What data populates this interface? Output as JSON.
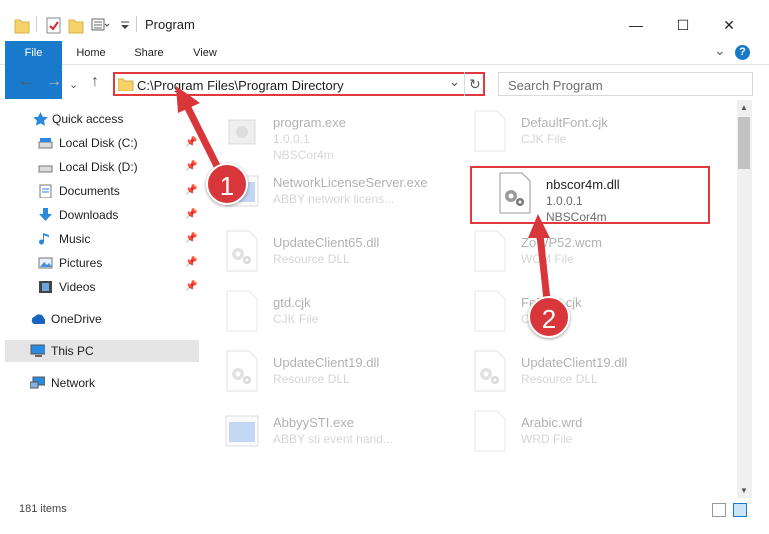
{
  "window": {
    "title": "Program",
    "minimize_glyph": "—",
    "maximize_glyph": "☐",
    "close_glyph": "✕"
  },
  "ribbon": {
    "tabs": [
      "File",
      "Home",
      "Share",
      "View"
    ],
    "collapse_glyph": "⌄",
    "help_glyph": "?"
  },
  "address": {
    "path": "C:\\Program Files\\Program Directory",
    "dropdown_glyph": "⌄",
    "refresh_glyph": "↻"
  },
  "search": {
    "placeholder": "Search Program"
  },
  "sidebar": {
    "items": [
      {
        "label": "Quick access",
        "icon": "star-icon",
        "pinned": false
      },
      {
        "label": "Local Disk (C:)",
        "icon": "drive-icon",
        "pinned": true
      },
      {
        "label": "Local Disk (D:)",
        "icon": "drive-icon",
        "pinned": true
      },
      {
        "label": "Documents",
        "icon": "documents-icon",
        "pinned": true
      },
      {
        "label": "Downloads",
        "icon": "download-icon",
        "pinned": true
      },
      {
        "label": "Music",
        "icon": "music-icon",
        "pinned": true
      },
      {
        "label": "Pictures",
        "icon": "pictures-icon",
        "pinned": true
      },
      {
        "label": "Videos",
        "icon": "videos-icon",
        "pinned": true
      },
      {
        "label": "OneDrive",
        "icon": "cloud-icon",
        "pinned": false
      },
      {
        "label": "This PC",
        "icon": "computer-icon",
        "pinned": false,
        "selected": true
      },
      {
        "label": "Network",
        "icon": "network-icon",
        "pinned": false
      }
    ]
  },
  "files": [
    {
      "name": "program.exe",
      "line2": "1.0.0.1",
      "line3": "NBSCor4m",
      "icon": "program-exe-icon"
    },
    {
      "name": "DefaultFont.cjk",
      "line2": "CJK File",
      "line3": "",
      "icon": "file-icon"
    },
    {
      "name": "NetworkLicenseServer.exe",
      "line2": "ABBY network licens...",
      "line3": "",
      "icon": "exe-icon"
    },
    {
      "name": "nbscor4m.dll",
      "line2": "1.0.0.1",
      "line3": "NBSCor4m",
      "icon": "dll-gear-icon",
      "highlighted": true
    },
    {
      "name": "UpdateClient65.dll",
      "line2": "Resource DLL",
      "line3": "",
      "icon": "dll-gear-icon"
    },
    {
      "name": "ZoWP52.wcm",
      "line2": "WCM File",
      "line3": "",
      "icon": "file-icon"
    },
    {
      "name": "gtd.cjk",
      "line2": "CJK File",
      "line3": "",
      "icon": "file-icon"
    },
    {
      "name": "FeFont.cjk",
      "line2": "CJK File",
      "line3": "",
      "icon": "file-icon"
    },
    {
      "name": "UpdateClient19.dll",
      "line2": "Resource DLL",
      "line3": "",
      "icon": "dll-gear-icon"
    },
    {
      "name": "UpdateClient19.dll",
      "line2": "Resource DLL",
      "line3": "",
      "icon": "dll-gear-icon"
    },
    {
      "name": "AbbyySTI.exe",
      "line2": "ABBY sti event hand...",
      "line3": "",
      "icon": "exe-icon"
    },
    {
      "name": "Arabic.wrd",
      "line2": "WRD File",
      "line3": "",
      "icon": "file-icon"
    }
  ],
  "status": {
    "item_count": "181 items"
  },
  "annotations": {
    "step1": "1",
    "step2": "2",
    "color": "#d9363b"
  }
}
